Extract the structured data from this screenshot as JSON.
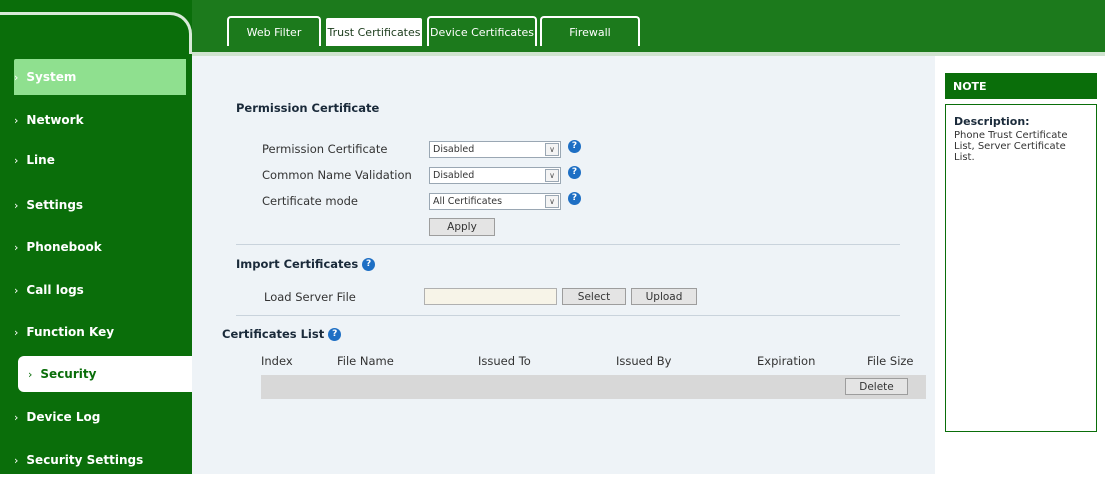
{
  "tabs": [
    {
      "label": "Web Filter",
      "active": false
    },
    {
      "label": "Trust Certificates",
      "active": true
    },
    {
      "label": "Device Certificates",
      "active": false
    },
    {
      "label": "Firewall",
      "active": false
    }
  ],
  "sidebar": {
    "items": [
      {
        "label": "System"
      },
      {
        "label": "Network"
      },
      {
        "label": "Line"
      },
      {
        "label": "Settings"
      },
      {
        "label": "Phonebook"
      },
      {
        "label": "Call logs"
      },
      {
        "label": "Function Key"
      },
      {
        "label": "Security"
      },
      {
        "label": "Device Log"
      },
      {
        "label": "Security Settings"
      }
    ]
  },
  "permission": {
    "title": "Permission Certificate",
    "rows": [
      {
        "label": "Permission Certificate",
        "value": "Disabled"
      },
      {
        "label": "Common Name Validation",
        "value": "Disabled"
      },
      {
        "label": "Certificate mode",
        "value": "All Certificates"
      }
    ],
    "apply_label": "Apply"
  },
  "import": {
    "title": "Import Certificates",
    "load_label": "Load Server File",
    "file_value": "",
    "select_label": "Select",
    "upload_label": "Upload"
  },
  "cert_list": {
    "title": "Certificates List",
    "columns": [
      "Index",
      "File Name",
      "Issued To",
      "Issued By",
      "Expiration",
      "File Size"
    ],
    "delete_label": "Delete"
  },
  "note": {
    "title": "NOTE",
    "desc_title": "Description:",
    "desc": "Phone Trust Certificate List, Server Certificate List."
  },
  "colors": {
    "brand_green": "#0a6e0a",
    "highlight_green": "#8fe08f",
    "help_blue": "#1e6fc4"
  }
}
